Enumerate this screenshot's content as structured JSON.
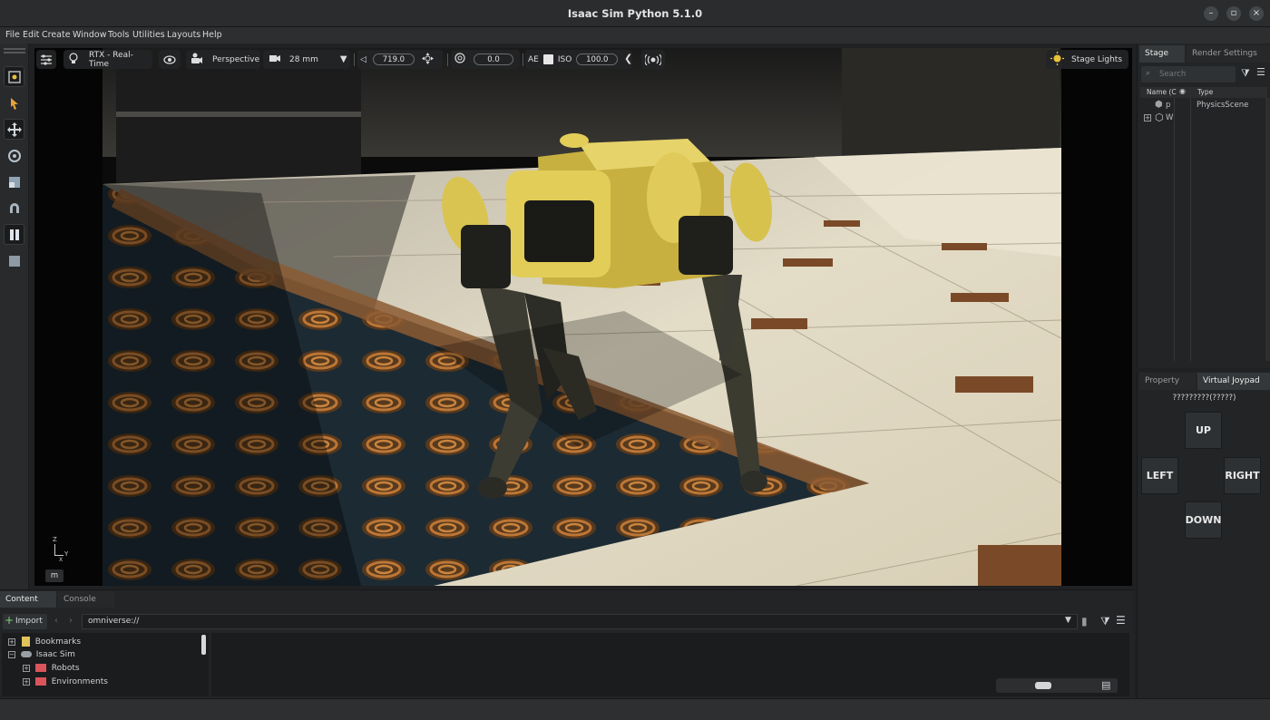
{
  "window": {
    "title": "Isaac Sim Python 5.1.0",
    "minimize_icon": "minimize-icon",
    "restore_icon": "restore-icon",
    "close_icon": "close-icon"
  },
  "menu": [
    "File",
    "Edit",
    "Create",
    "Window",
    "Tools",
    "Utilities",
    "Layouts",
    "Help"
  ],
  "left_tools": [
    "select-icon",
    "pointer-icon",
    "move-icon",
    "rotate-icon",
    "scale-icon",
    "snap-icon",
    "pause-icon",
    "stop-icon"
  ],
  "viewport_toolbar": {
    "renderer": "RTX - Real-Time",
    "camera": "Perspective",
    "lens": "28 mm",
    "focus_distance": "719.0",
    "fstop": "0.0",
    "ae_label": "AE",
    "iso_label": "ISO",
    "iso_value": "100.0",
    "stage_lights": "Stage Lights"
  },
  "viewport": {
    "axis_z": "Z",
    "axis_y": "Y",
    "axis_x": "X",
    "units_badge": "m"
  },
  "stage_panel": {
    "tabs": [
      "Stage",
      "Render Settings"
    ],
    "search_placeholder": "Search",
    "col_name": "Name (C",
    "col_type": "Type",
    "rows": [
      {
        "name": "p",
        "type": "PhysicsScene"
      },
      {
        "name": "W",
        "type": ""
      }
    ]
  },
  "property_panel": {
    "tabs": [
      "Property",
      "Virtual Joypad"
    ],
    "header": "?????????(?????)",
    "up": "UP",
    "left": "LEFT",
    "right": "RIGHT",
    "down": "DOWN"
  },
  "content_panel": {
    "tabs": [
      "Content",
      "Console"
    ],
    "import_label": "Import",
    "path": "omniverse://",
    "tree": [
      {
        "label": "Bookmarks",
        "icon": "bookmark-folder-icon",
        "level": 0,
        "sign": "+"
      },
      {
        "label": "Isaac Sim",
        "icon": "cloud-icon",
        "level": 0,
        "sign": "−"
      },
      {
        "label": "Robots",
        "icon": "folder-icon",
        "level": 1,
        "sign": "+"
      },
      {
        "label": "Environments",
        "icon": "folder-icon",
        "level": 1,
        "sign": "+"
      }
    ]
  },
  "colors": {
    "accent_yellow": "#e9c23a",
    "panel_bg": "#222426",
    "titlebar_bg": "#2a2c2e"
  }
}
